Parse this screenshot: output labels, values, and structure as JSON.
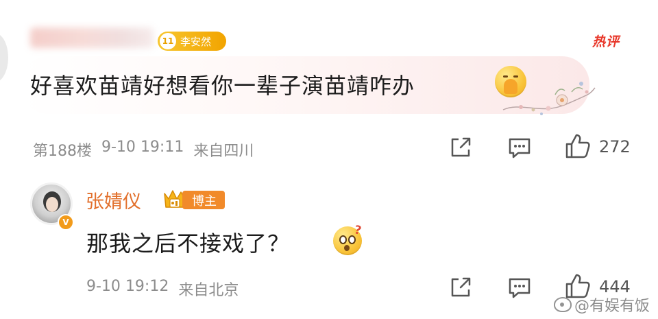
{
  "comment": {
    "user_level": "11",
    "user_level_name": "李安然",
    "hot_tag": "热评",
    "text": "好喜欢苗靖好想看你一辈子演苗靖咋办",
    "floor": "第188楼",
    "date": "9-10",
    "time": "19:11",
    "location": "来自四川",
    "like_count": "272",
    "emoji": "pray-face-icon"
  },
  "reply": {
    "username": "张婧仪",
    "badge": "博主",
    "text": "那我之后不接戏了？",
    "date": "9-10",
    "time": "19:12",
    "location": "来自北京",
    "like_count": "444",
    "emoji": "thinking-face-icon"
  },
  "watermark": {
    "text": "@有娱有饭"
  },
  "colors": {
    "username_orange": "#e2702c",
    "hot_red": "#e8382b",
    "meta_gray": "#8c8c8c",
    "badge_gold": "#f2a400",
    "blogger_orange": "#f18a2a"
  }
}
